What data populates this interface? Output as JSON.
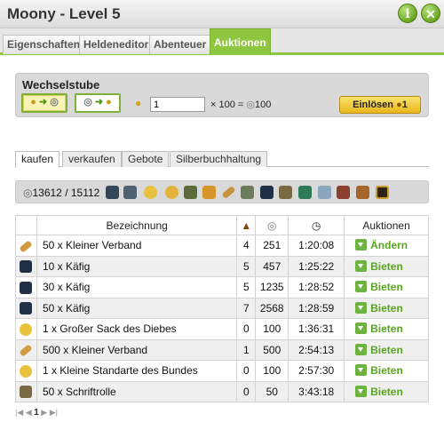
{
  "window": {
    "title": "Moony - Level 5",
    "help_glyph": "i",
    "close_glyph": "✕"
  },
  "main_tabs": [
    {
      "label": "Eigenschaften"
    },
    {
      "label": "Heldeneditor"
    },
    {
      "label": "Abenteuer"
    },
    {
      "label": "Auktionen"
    }
  ],
  "exchange": {
    "title": "Wechselstube",
    "gold_to_silver_arrow": "➜",
    "silver_to_gold_arrow": "➜",
    "amount_value": "1",
    "formula_prefix": "× 100 =",
    "formula_result": "100",
    "redeem_label": "Einlösen",
    "redeem_cost": "1"
  },
  "sub_tabs": [
    {
      "label": "kaufen"
    },
    {
      "label": "verkaufen"
    },
    {
      "label": "Gebote"
    },
    {
      "label": "Silberbuchhaltung"
    }
  ],
  "filter": {
    "silver_count": "13612 / 15112"
  },
  "table": {
    "headers": {
      "name": "Bezeichnung",
      "auctions": "Auktionen"
    },
    "rows": [
      {
        "name": "50 x Kleiner Verband",
        "level": "4",
        "price": "251",
        "time": "1:20:08",
        "action": "Ändern"
      },
      {
        "name": "10 x Käfig",
        "level": "5",
        "price": "457",
        "time": "1:25:22",
        "action": "Bieten"
      },
      {
        "name": "30 x Käfig",
        "level": "5",
        "price": "1235",
        "time": "1:28:52",
        "action": "Bieten"
      },
      {
        "name": "50 x Käfig",
        "level": "7",
        "price": "2568",
        "time": "1:28:59",
        "action": "Bieten"
      },
      {
        "name": "1 x Großer Sack des Diebes",
        "level": "0",
        "price": "100",
        "time": "1:36:31",
        "action": "Bieten"
      },
      {
        "name": "500 x Kleiner Verband",
        "level": "1",
        "price": "500",
        "time": "2:54:13",
        "action": "Bieten"
      },
      {
        "name": "1 x Kleine Standarte des Bundes",
        "level": "0",
        "price": "100",
        "time": "2:57:30",
        "action": "Bieten"
      },
      {
        "name": "50 x Schriftrolle",
        "level": "0",
        "price": "50",
        "time": "3:43:18",
        "action": "Bieten"
      }
    ]
  },
  "pager": {
    "first": "|◀",
    "prev": "◀",
    "current": "1",
    "next": "▶",
    "last": "▶|"
  },
  "colors": {
    "accent": "#8ec63f",
    "action": "#5aa51f",
    "gold": "#e9b61d"
  }
}
